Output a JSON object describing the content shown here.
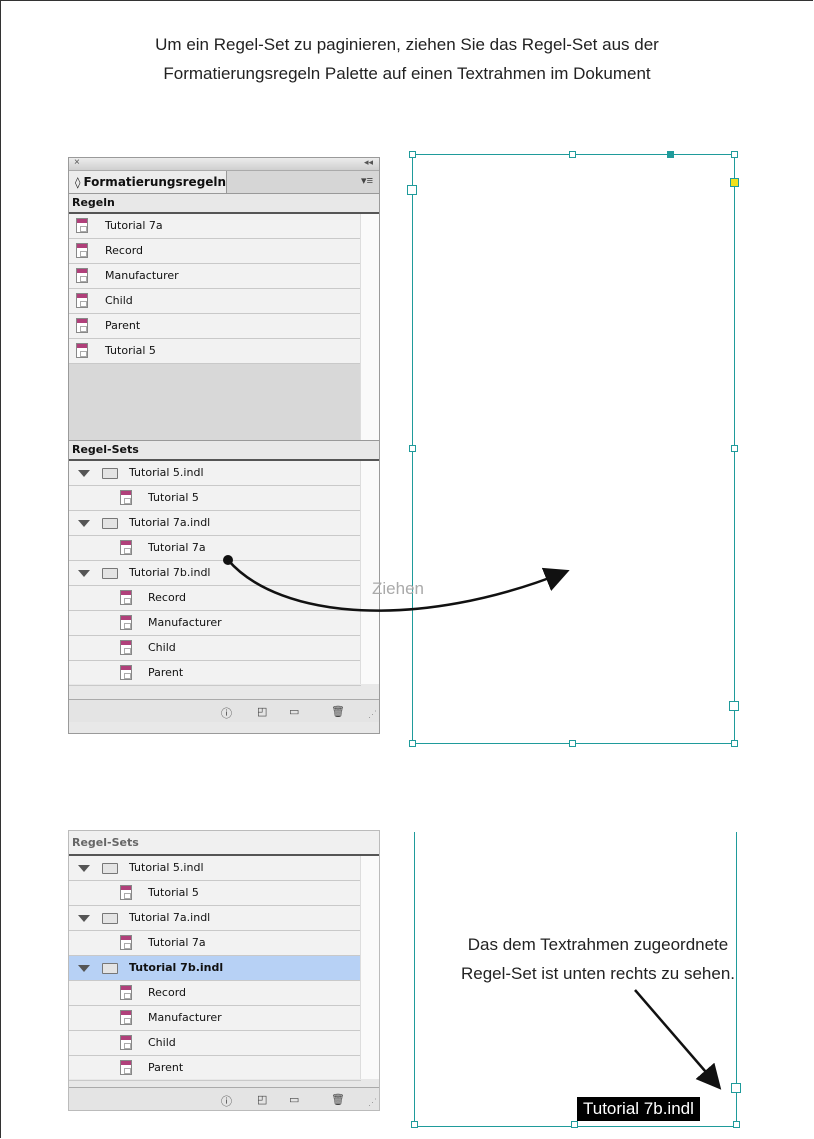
{
  "instructions": {
    "line1": "Um ein Regel-Set zu paginieren, ziehen Sie das Regel-Set aus der",
    "line2": "Formatierungsregeln Palette auf einen Textrahmen im Dokument"
  },
  "palette": {
    "close_glyph": "×",
    "collapse_glyph": "◂◂",
    "tab_updown": "◊",
    "tab_title": "Formatierungsregeln",
    "menu_glyph": "▾≡",
    "rules_label": "Regeln",
    "rules": [
      "Tutorial 7a",
      "Record",
      "Manufacturer",
      "Child",
      "Parent",
      "Tutorial 5"
    ],
    "sets_label": "Regel-Sets"
  },
  "rule_sets": [
    {
      "type": "folder",
      "label": "Tutorial 5.indl"
    },
    {
      "type": "doc",
      "label": "Tutorial 5"
    },
    {
      "type": "folder",
      "label": "Tutorial 7a.indl"
    },
    {
      "type": "doc",
      "label": "Tutorial 7a"
    },
    {
      "type": "folder",
      "label": "Tutorial 7b.indl"
    },
    {
      "type": "doc",
      "label": "Record"
    },
    {
      "type": "doc",
      "label": "Manufacturer"
    },
    {
      "type": "doc",
      "label": "Child"
    },
    {
      "type": "doc",
      "label": "Parent"
    }
  ],
  "bottom_icons": [
    "info-icon",
    "new-rule-icon",
    "new-folder-icon",
    "trash-icon"
  ],
  "drag_label": "Ziehen",
  "annotation": {
    "line1": "Das dem Textrahmen zugeordnete",
    "line2": "Regel-Set ist unten rechts zu sehen."
  },
  "assigned_set_badge": "Tutorial 7b.indl",
  "selected_set": "Tutorial 7b.indl",
  "colors": {
    "frame": "#1f9b9b",
    "selection": "#b7d1f5",
    "doc_icon": "#b0407a"
  }
}
